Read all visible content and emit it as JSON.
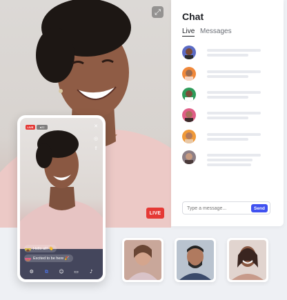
{
  "main_video": {
    "live_label": "LIVE",
    "expand_icon": "expand-icon"
  },
  "chat": {
    "title": "Chat",
    "tabs": [
      {
        "label": "Live",
        "active": true
      },
      {
        "label": "Messages",
        "active": false
      }
    ],
    "participants": [
      {
        "avatar": "avatar-man-beard",
        "bg": "#5b6bc4"
      },
      {
        "avatar": "avatar-woman-orange",
        "bg": "#f0883a"
      },
      {
        "avatar": "avatar-woman-green",
        "bg": "#2e9c5a"
      },
      {
        "avatar": "avatar-man-pink",
        "bg": "#e05d86"
      },
      {
        "avatar": "avatar-woman-orange-2",
        "bg": "#f09a3a"
      },
      {
        "avatar": "avatar-woman-grey",
        "bg": "#8d7f86"
      }
    ],
    "input_placeholder": "Type a message...",
    "send_label": "Send",
    "accent": "#3f51f0"
  },
  "phone": {
    "live_label": "LIVE",
    "viewer_count": "22",
    "messages": [
      {
        "text": "Hello all! 👋"
      },
      {
        "text": "Excited to be here 🎉"
      }
    ],
    "toolbar": [
      "settings-icon",
      "share-icon",
      "people-icon",
      "camera-icon",
      "mic-icon"
    ]
  },
  "thumbnails": [
    {
      "name": "participant-woman-thumbnail"
    },
    {
      "name": "participant-man-thumbnail"
    },
    {
      "name": "participant-woman-smiling-thumbnail"
    }
  ],
  "colors": {
    "live_red": "#e53935",
    "background": "#eef0f4"
  }
}
